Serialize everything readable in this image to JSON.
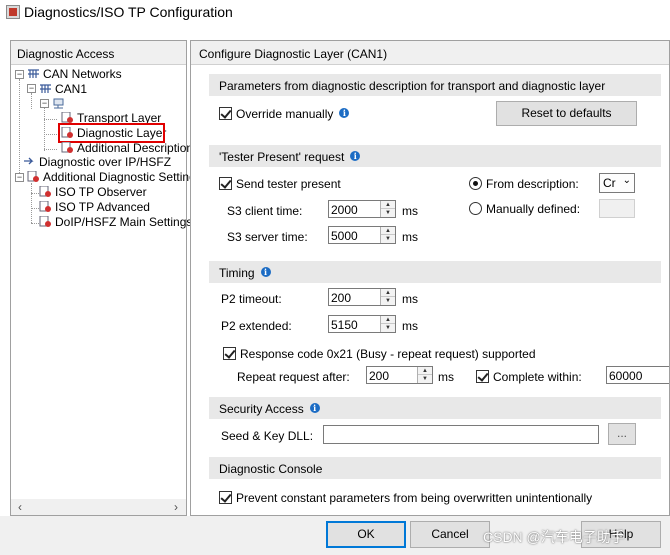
{
  "window": {
    "title": "Diagnostics/ISO TP Configuration"
  },
  "left_panel": {
    "header": "Diagnostic Access",
    "tree": {
      "can_networks": "CAN Networks",
      "can1": "CAN1",
      "transport_layer": "Transport Layer",
      "diagnostic_layer": "Diagnostic Layer",
      "additional_descriptions": "Additional Descriptions",
      "diagnostic_over_ip": "Diagnostic over IP/HSFZ",
      "additional_settings": "Additional Diagnostic Settings",
      "iso_tp_observer": "ISO TP Observer",
      "iso_tp_advanced": "ISO TP Advanced",
      "doip_main_settings": "DoIP/HSFZ Main Settings"
    },
    "selected_item": "Diagnostic Layer"
  },
  "right_panel": {
    "header": "Configure Diagnostic Layer (CAN1)",
    "params_section": {
      "title": "Parameters from diagnostic description for transport and diagnostic layer",
      "override_label": "Override manually",
      "override_checked": true,
      "reset_button": "Reset to defaults"
    },
    "tester_present": {
      "title": "'Tester Present' request",
      "send_label": "Send tester present",
      "send_checked": true,
      "s3_client_label": "S3 client time:",
      "s3_client_value": "2000",
      "s3_server_label": "S3 server time:",
      "s3_server_value": "5000",
      "unit_ms": "ms",
      "from_description_label": "From description:",
      "from_description_selected": true,
      "from_description_value": "Cr",
      "manually_defined_label": "Manually defined:"
    },
    "timing": {
      "title": "Timing",
      "p2_timeout_label": "P2 timeout:",
      "p2_timeout_value": "200",
      "p2_extended_label": "P2 extended:",
      "p2_extended_value": "5150",
      "unit_ms": "ms",
      "response_code_label": "Response code 0x21 (Busy - repeat request) supported",
      "response_code_checked": true,
      "repeat_label": "Repeat request after:",
      "repeat_value": "200",
      "complete_within_label": "Complete within:",
      "complete_within_checked": true,
      "complete_within_value": "60000"
    },
    "security": {
      "title": "Security Access",
      "seed_key_label": "Seed & Key DLL:",
      "seed_key_value": "",
      "browse_button": "..."
    },
    "console": {
      "title": "Diagnostic Console",
      "prevent_label": "Prevent constant parameters from being overwritten unintentionally",
      "prevent_checked": true
    }
  },
  "buttons": {
    "ok": "OK",
    "cancel": "Cancel",
    "help": "Help"
  },
  "watermark": "CSDN @汽车电子助手",
  "icons": {
    "app": "app-window-icon",
    "info": "info-icon",
    "network": "network-icon",
    "node": "node-icon",
    "doc": "document-icon"
  },
  "colors": {
    "selection_border": "#e00000",
    "info_icon": "#1c6cc4",
    "section_header": "#e8e8e8"
  }
}
